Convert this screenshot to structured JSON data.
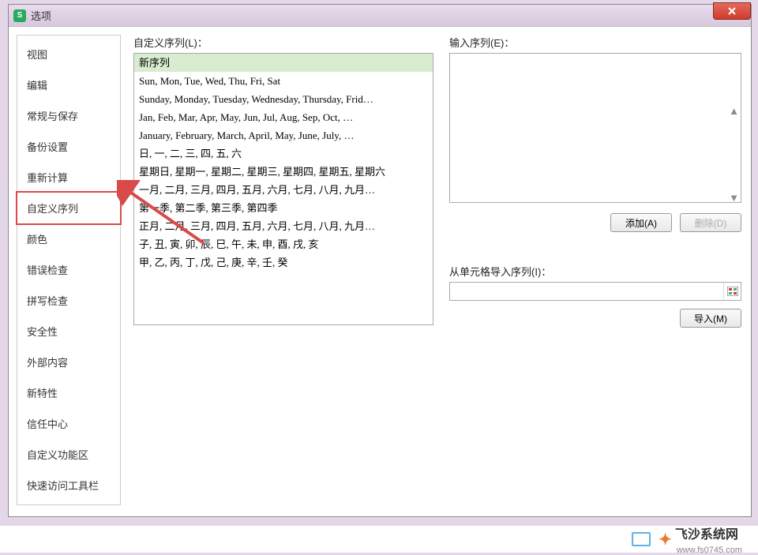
{
  "window": {
    "title": "选项"
  },
  "sidebar": {
    "items": [
      {
        "label": "视图"
      },
      {
        "label": "编辑"
      },
      {
        "label": "常规与保存"
      },
      {
        "label": "备份设置"
      },
      {
        "label": "重新计算"
      },
      {
        "label": "自定义序列"
      },
      {
        "label": "颜色"
      },
      {
        "label": "错误检查"
      },
      {
        "label": "拼写检查"
      },
      {
        "label": "安全性"
      },
      {
        "label": "外部内容"
      },
      {
        "label": "新特性"
      },
      {
        "label": "信任中心"
      },
      {
        "label": "自定义功能区"
      },
      {
        "label": "快速访问工具栏"
      }
    ],
    "selected_index": 5
  },
  "main": {
    "custom_list_label": "自定义序列(L)：",
    "custom_list_items": [
      "新序列",
      "Sun, Mon, Tue, Wed, Thu, Fri, Sat",
      "Sunday, Monday, Tuesday, Wednesday, Thursday, Frid…",
      "Jan, Feb, Mar, Apr, May, Jun, Jul, Aug, Sep, Oct, …",
      "January, February, March, April, May, June, July, …",
      "日, 一, 二, 三, 四, 五, 六",
      "星期日, 星期一, 星期二, 星期三, 星期四, 星期五, 星期六",
      "一月, 二月, 三月, 四月, 五月, 六月, 七月, 八月, 九月…",
      "第一季, 第二季, 第三季, 第四季",
      "正月, 二月, 三月, 四月, 五月, 六月, 七月, 八月, 九月…",
      "子, 丑, 寅, 卯, 辰, 巳, 午, 未, 申, 酉, 戌, 亥",
      "甲, 乙, 丙, 丁, 戊, 己, 庚, 辛, 壬, 癸"
    ],
    "highlighted_index": 0,
    "input_label": "输入序列(E)：",
    "add_button": "添加(A)",
    "delete_button": "删除(D)",
    "import_label": "从单元格导入序列(I)：",
    "import_button": "导入(M)"
  },
  "footer": {
    "brand": "飞沙系统网",
    "url": "www.fs0745.com"
  }
}
